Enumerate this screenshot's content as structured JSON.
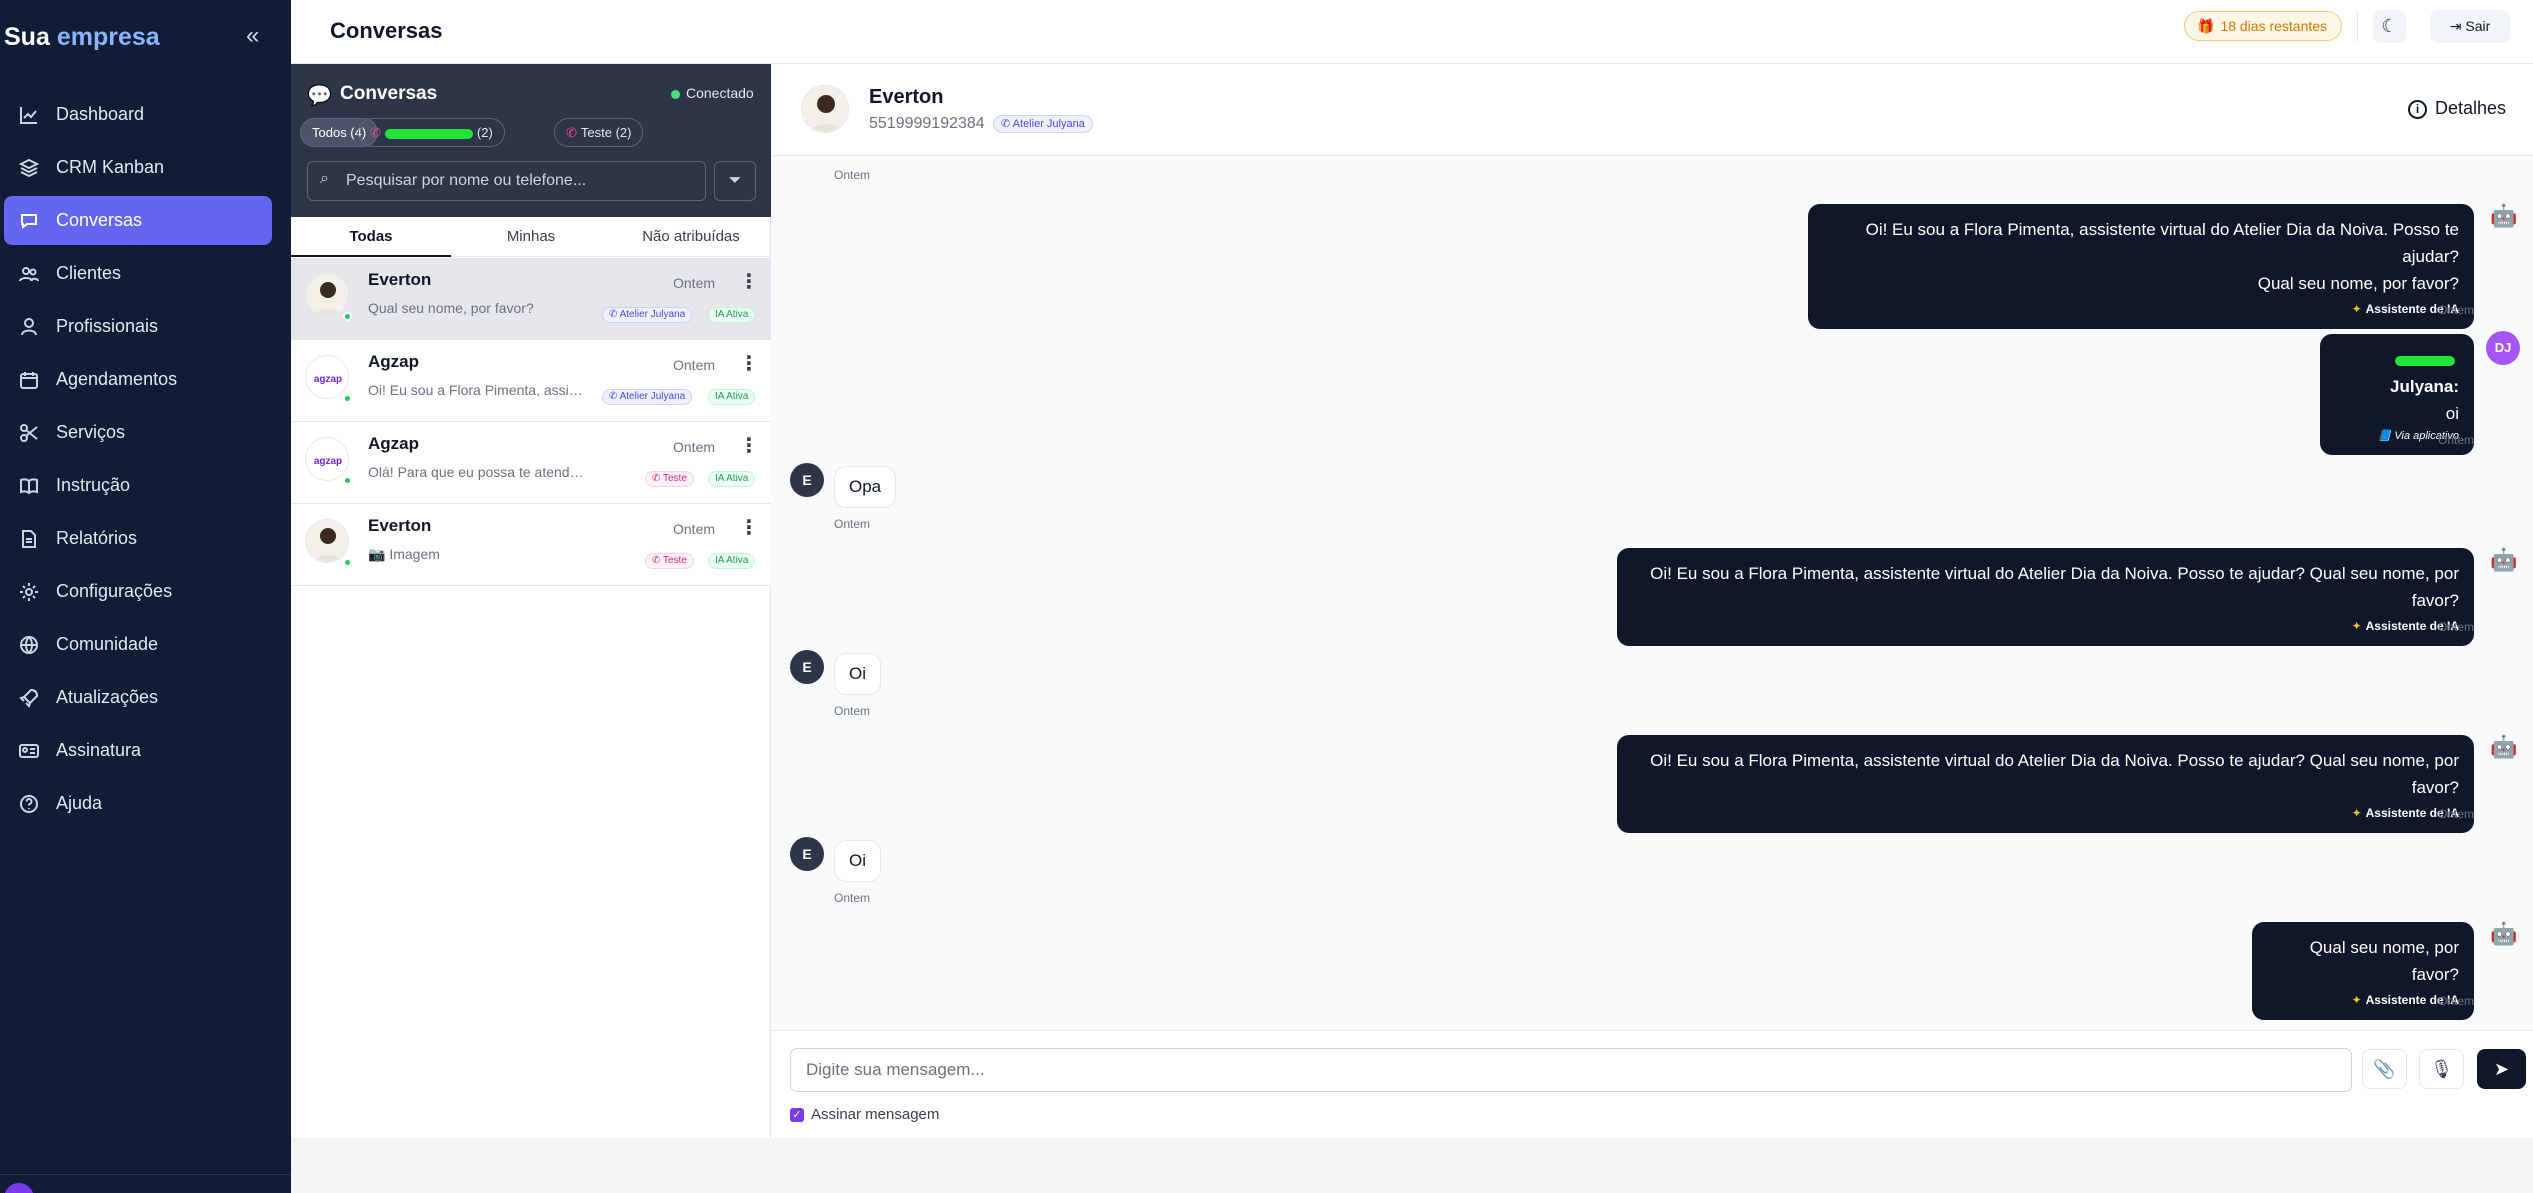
{
  "brand": {
    "word1": "Sua",
    "word2": "empresa"
  },
  "sidebar": {
    "items": [
      {
        "label": "Dashboard",
        "icon": "chart-line-icon"
      },
      {
        "label": "CRM Kanban",
        "icon": "layers-icon"
      },
      {
        "label": "Conversas",
        "icon": "chat-bubble-icon",
        "active": true
      },
      {
        "label": "Clientes",
        "icon": "users-icon"
      },
      {
        "label": "Profissionais",
        "icon": "user-icon"
      },
      {
        "label": "Agendamentos",
        "icon": "calendar-icon"
      },
      {
        "label": "Serviços",
        "icon": "scissors-icon"
      },
      {
        "label": "Instrução",
        "icon": "book-icon"
      },
      {
        "label": "Relatórios",
        "icon": "report-icon"
      },
      {
        "label": "Configurações",
        "icon": "gear-icon"
      },
      {
        "label": "Comunidade",
        "icon": "globe-icon"
      },
      {
        "label": "Atualizações",
        "icon": "rocket-icon"
      },
      {
        "label": "Assinatura",
        "icon": "id-card-icon"
      },
      {
        "label": "Ajuda",
        "icon": "help-circle-icon"
      }
    ]
  },
  "header": {
    "title": "Conversas",
    "trial_badge": "18 dias restantes",
    "logout": "Sair"
  },
  "panel": {
    "title": "Conversas",
    "status": "Conectado",
    "chips": {
      "all": "Todos (4)",
      "second_count": "(2)",
      "teste": "Teste (2)"
    },
    "search_placeholder": "Pesquisar por nome ou telefone...",
    "tabs": [
      "Todas",
      "Minhas",
      "Não atribuídas"
    ],
    "conversations": [
      {
        "name": "Everton",
        "preview": "Qual seu nome, por favor?",
        "time": "Ontem",
        "tag": "Atelier Julyana",
        "ai": "IA Ativa"
      },
      {
        "name": "Agzap",
        "preview": "Oi! Eu sou a Flora Pimenta, assistente virtual do Atelier Dia da Noiva.",
        "time": "Ontem",
        "tag": "Atelier Julyana",
        "ai": "IA Ativa"
      },
      {
        "name": "Agzap",
        "preview": "Olá! Para que eu possa te atender melhor, qual seu nome?",
        "time": "Ontem",
        "tag": "Teste",
        "ai": "IA Ativa"
      },
      {
        "name": "Everton",
        "preview": "📷 Imagem",
        "time": "Ontem",
        "tag": "Teste",
        "ai": "IA Ativa"
      }
    ]
  },
  "chat": {
    "name": "Everton",
    "phone": "5519999192384",
    "tag": "Atelier Julyana",
    "details": "Detalhes",
    "top_stamp": "Ontem",
    "m1": {
      "line1": "Oi! Eu sou a Flora Pimenta, assistente virtual do Atelier Dia da Noiva. Posso te ajudar?",
      "line2": "Qual seu nome, por favor?",
      "badge": "Assistente de IA",
      "time": "Ontem"
    },
    "m2": {
      "author": "Julyana:",
      "text": "oi",
      "via": "Via aplicativo",
      "time": "Ontem",
      "avatar": "DJ"
    },
    "m3": {
      "text": "Opa",
      "time": "Ontem",
      "avatar": "E"
    },
    "m4": {
      "text": "Oi! Eu sou a Flora Pimenta, assistente virtual do Atelier Dia da Noiva. Posso te ajudar? Qual seu nome, por favor?",
      "badge": "Assistente de IA",
      "time": "Ontem"
    },
    "m5": {
      "text": "Oi",
      "time": "Ontem",
      "avatar": "E"
    },
    "m6": {
      "text": "Oi! Eu sou a Flora Pimenta, assistente virtual do Atelier Dia da Noiva. Posso te ajudar? Qual seu nome, por favor?",
      "badge": "Assistente de IA",
      "time": "Ontem"
    },
    "m7": {
      "text": "Oi",
      "time": "Ontem",
      "avatar": "E"
    },
    "m8": {
      "text": "Qual seu nome, por favor?",
      "badge": "Assistente de IA",
      "time": "Ontem"
    }
  },
  "composer": {
    "placeholder": "Digite sua mensagem...",
    "sign_label": "Assinar mensagem"
  }
}
